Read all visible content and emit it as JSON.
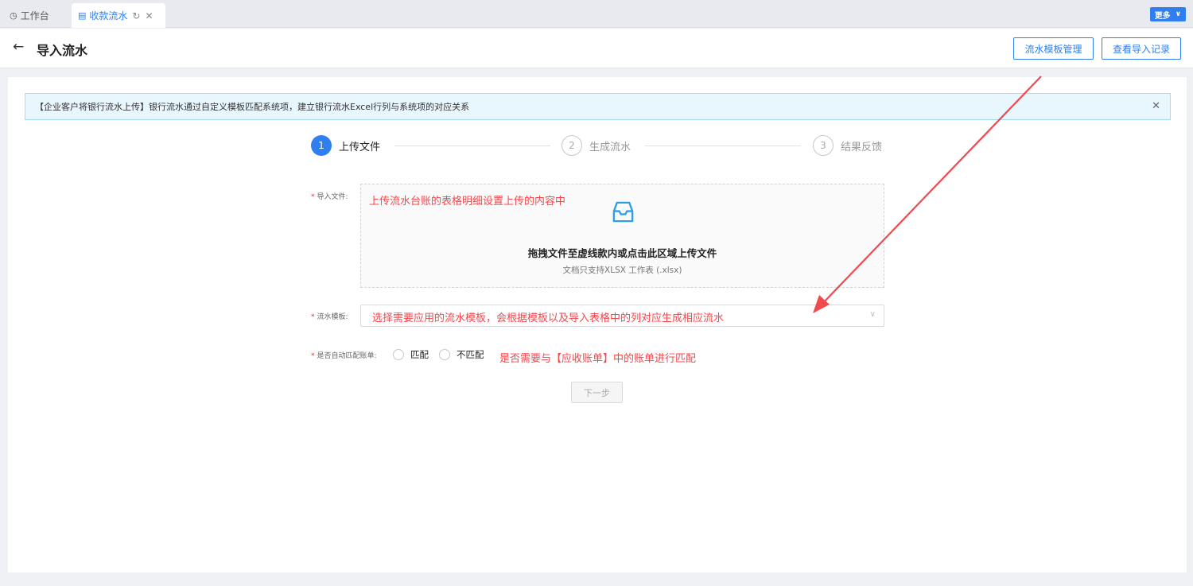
{
  "tabs": {
    "home_label": "工作台",
    "active_label": "收款流水",
    "more_label": "更多"
  },
  "header": {
    "title": "导入流水",
    "template_mgmt_label": "流水模板管理",
    "import_records_label": "查看导入记录"
  },
  "alert": {
    "text": "【企业客户将银行流水上传】银行流水通过自定义模板匹配系统项，建立银行流水Excel行列与系统项的对应关系"
  },
  "steps": [
    {
      "num": "1",
      "label": "上传文件"
    },
    {
      "num": "2",
      "label": "生成流水"
    },
    {
      "num": "3",
      "label": "结果反馈"
    }
  ],
  "form": {
    "file_label": "导入文件:",
    "upload_text": "拖拽文件至虚线款内或点击此区域上传文件",
    "upload_hint": "文档只支持XLSX 工作表 (.xlsx)",
    "template_label": "流水模板:",
    "auto_match_label": "是否自动匹配账单:",
    "radio_match": "匹配",
    "radio_no_match": "不匹配",
    "next_label": "下一步"
  },
  "annotations": {
    "upload": "上传流水台账的表格明细设置上传的内容中",
    "template": "选择需要应用的流水模板，会根据模板以及导入表格中的列对应生成相应流水",
    "match": "是否需要与【应收账单】中的账单进行匹配"
  },
  "colors": {
    "primary": "#2f7ff0",
    "annotation": "#f5464b",
    "alert_bg": "#e8f6fd"
  }
}
